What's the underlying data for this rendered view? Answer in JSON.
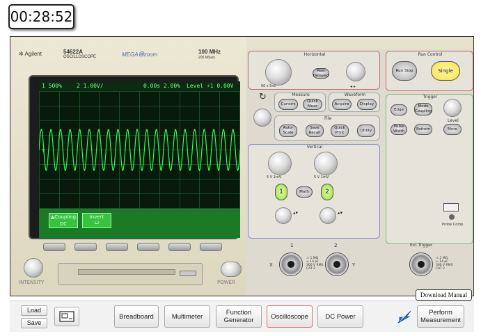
{
  "timer": {
    "value": "00:28:52"
  },
  "scope": {
    "brand": "Agilent",
    "model": "54622A",
    "model_sub": "OSCILLOSCOPE",
    "mega": "MEGA",
    "zoom": "zoom",
    "bandwidth": "100 MHz",
    "sample_rate": "200 MSa/s",
    "intensity_label": "INTENSITY",
    "power_label": "POWER",
    "status": {
      "ch1": "1  500%",
      "ch2": "2  1.00V/",
      "time": "0.00s  2.00%",
      "trigger": "Level  ⚡1  0.00V"
    },
    "softkeys": [
      {
        "top": "▲Coupling",
        "bottom": "DC"
      },
      {
        "top": "Invert",
        "bottom": "└┘"
      }
    ],
    "horizontal": {
      "title": "Horizontal",
      "main_delayed": "Main Delayed",
      "time_labels": "50 s    5ns"
    },
    "run_control": {
      "title": "Run Control",
      "run_stop": "Run Stop",
      "single": "Single"
    },
    "measure": {
      "title": "Measure",
      "cursors": "Cursors",
      "quick_meas": "Quick Meas"
    },
    "waveform": {
      "title": "Waveform",
      "acquire": "Acquire",
      "display": "Display"
    },
    "file": {
      "title": "File",
      "auto_scale": "Auto-Scale",
      "save_recall": "Save Recall",
      "quick_print": "Quick Print",
      "utility": "Utility"
    },
    "trigger": {
      "title": "Trigger",
      "edge": "Edge",
      "mode_coupling": "Mode Coupling",
      "level": "Level",
      "pulse_width": "Pulse Width",
      "pattern": "Pattern",
      "more": "More"
    },
    "vertical": {
      "title": "Vertical",
      "v_left": "5 V    1mV",
      "v_right": "5 V    1mV",
      "ch1": "1",
      "ch2": "2",
      "math": "Math"
    },
    "inputs": {
      "ch1_label": "1",
      "ch2_label": "2",
      "x": "X",
      "y": "Y",
      "spec": "⚠ 1 MΩ\n≈ 14 pF\n300 V RMS\nCAT 2",
      "probe_comp": "Probe Comp",
      "ext_trigger": "Ext Trigger"
    }
  },
  "download_manual": "Download Manual",
  "toolbar": {
    "load": "Load",
    "save": "Save",
    "buttons": [
      "Breadboard",
      "Multimeter",
      "Function Generator",
      "Oscilloscope",
      "DC Power",
      "Perform Measurement"
    ]
  },
  "colors": {
    "trace": "#30ff50",
    "screen_bg": "#071a0c",
    "single_button": "#f4e34a",
    "active_tab_border": "#d96a6a"
  },
  "waveform_data": {
    "cycles": 21,
    "amplitude_divisions": 1.4
  }
}
